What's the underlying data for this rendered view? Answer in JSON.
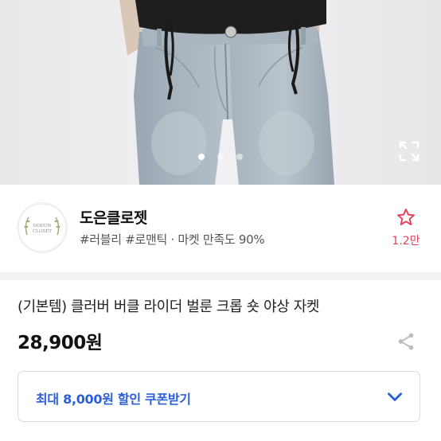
{
  "carousel": {
    "dot_count": 3,
    "active_index": 0
  },
  "shop": {
    "name": "도은클로젯",
    "logo_text_top": "DOEUN",
    "logo_text_bottom": "CLOSET",
    "tags": "#러블리 #로맨틱 · 마켓 만족도 90%",
    "favorite_count": "1.2만"
  },
  "product": {
    "title": "(기본템) 클러버 버클 라이더 벌룬 크롭 숏 야상 자켓",
    "price": "28,900원"
  },
  "coupon": {
    "label": "최대 8,000원 할인 쿠폰받기"
  },
  "colors": {
    "accent_blue": "#2b5fd9",
    "favorite_pink": "#e8415a"
  }
}
